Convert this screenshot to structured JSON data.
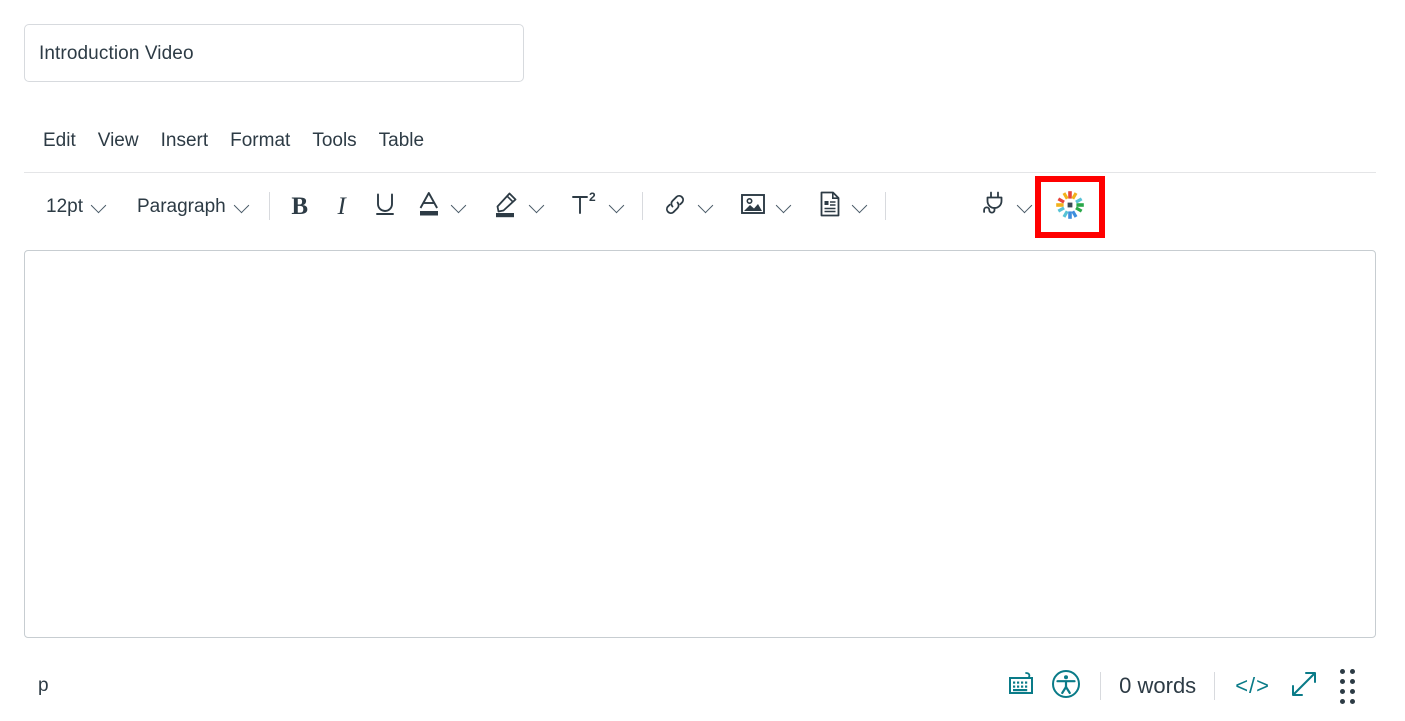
{
  "title_field": {
    "value": "Introduction Video",
    "placeholder": "Title"
  },
  "menubar": {
    "items": [
      {
        "label": "Edit",
        "name": "menu-edit"
      },
      {
        "label": "View",
        "name": "menu-view"
      },
      {
        "label": "Insert",
        "name": "menu-insert"
      },
      {
        "label": "Format",
        "name": "menu-format"
      },
      {
        "label": "Tools",
        "name": "menu-tools"
      },
      {
        "label": "Table",
        "name": "menu-table"
      }
    ]
  },
  "toolbar": {
    "font_size": {
      "label": "12pt",
      "icon": "chevron-down-icon"
    },
    "block_format": {
      "label": "Paragraph",
      "icon": "chevron-down-icon"
    },
    "bold": {
      "label": "B",
      "icon": "bold-icon"
    },
    "italic": {
      "label": "I",
      "icon": "italic-icon"
    },
    "underline": {
      "icon": "underline-icon"
    },
    "text_color": {
      "icon": "text-color-icon",
      "swatch": "#2d3b45"
    },
    "highlight": {
      "icon": "highlighter-icon",
      "swatch": "#2d3b45"
    },
    "superscript": {
      "label": "T2",
      "icon": "superscript-icon"
    },
    "link": {
      "icon": "link-icon"
    },
    "image": {
      "icon": "image-icon"
    },
    "document": {
      "icon": "document-icon"
    },
    "studio": {
      "icon": "studio-starburst-icon",
      "highlighted": true,
      "highlight_color": "#ff0000"
    },
    "apps": {
      "icon": "plug-icon"
    },
    "more": {
      "icon": "kebab-vertical-icon"
    }
  },
  "editor": {
    "content": "",
    "placeholder": ""
  },
  "statusbar": {
    "element_path": "p",
    "keyboard_shortcuts": {
      "icon": "keyboard-icon"
    },
    "accessibility_checker": {
      "icon": "accessibility-icon"
    },
    "word_count": "0 words",
    "html_editor": {
      "label": "</>",
      "icon": "code-icon"
    },
    "resize": {
      "icon": "resize-diagonal-icon"
    },
    "drag_handle": {
      "icon": "dot-grid-icon"
    }
  },
  "colors": {
    "text": "#2d3b45",
    "teal": "#0a7b88",
    "border": "#c7cdd1",
    "highlight_red": "#ff0000"
  }
}
